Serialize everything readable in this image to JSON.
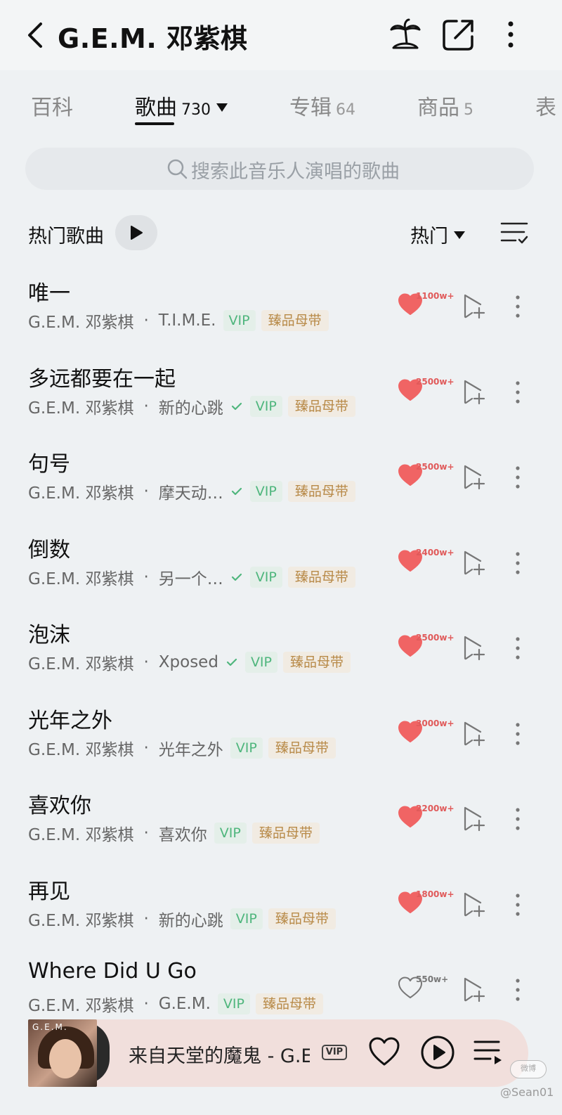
{
  "header": {
    "title": "G.E.M. 邓紫棋"
  },
  "tabs": [
    {
      "label": "百科",
      "count": ""
    },
    {
      "label": "歌曲",
      "count": "730"
    },
    {
      "label": "专辑",
      "count": "64"
    },
    {
      "label": "商品",
      "count": "5"
    },
    {
      "label": "表",
      "count": ""
    }
  ],
  "search": {
    "placeholder": "搜索此音乐人演唱的歌曲"
  },
  "section": {
    "title": "热门歌曲",
    "sort_label": "热门"
  },
  "songs": [
    {
      "title": "唯一",
      "artist": "G.E.M. 邓紫棋",
      "album": "T.I.M.E.",
      "verified": false,
      "vip": "VIP",
      "master": "臻品母带",
      "likes": "1100w+",
      "liked": true
    },
    {
      "title": "多远都要在一起",
      "artist": "G.E.M. 邓紫棋",
      "album": "新的心跳",
      "verified": true,
      "vip": "VIP",
      "master": "臻品母带",
      "likes": "2500w+",
      "liked": true
    },
    {
      "title": "句号",
      "artist": "G.E.M. 邓紫棋",
      "album": "摩天动…",
      "verified": true,
      "vip": "VIP",
      "master": "臻品母带",
      "likes": "2500w+",
      "liked": true
    },
    {
      "title": "倒数",
      "artist": "G.E.M. 邓紫棋",
      "album": "另一个…",
      "verified": true,
      "vip": "VIP",
      "master": "臻品母带",
      "likes": "2400w+",
      "liked": true
    },
    {
      "title": "泡沫",
      "artist": "G.E.M. 邓紫棋",
      "album": "Xposed",
      "verified": true,
      "vip": "VIP",
      "master": "臻品母带",
      "likes": "2500w+",
      "liked": true
    },
    {
      "title": "光年之外",
      "artist": "G.E.M. 邓紫棋",
      "album": "光年之外",
      "verified": false,
      "vip": "VIP",
      "master": "臻品母带",
      "likes": "3000w+",
      "liked": true
    },
    {
      "title": "喜欢你",
      "artist": "G.E.M. 邓紫棋",
      "album": "喜欢你",
      "verified": false,
      "vip": "VIP",
      "master": "臻品母带",
      "likes": "2200w+",
      "liked": true
    },
    {
      "title": "再见",
      "artist": "G.E.M. 邓紫棋",
      "album": "新的心跳",
      "verified": false,
      "vip": "VIP",
      "master": "臻品母带",
      "likes": "1800w+",
      "liked": true
    },
    {
      "title": "Where Did U Go",
      "artist": "G.E.M. 邓紫棋",
      "album": "G.E.M.",
      "verified": false,
      "vip": "VIP",
      "master": "臻品母带",
      "likes": "550w+",
      "liked": false
    }
  ],
  "player": {
    "song": "来自天堂的魔鬼 - G.E.M. 邓紫棋",
    "vip_badge": "VIP",
    "cover_text": "G.E.M."
  },
  "watermark": {
    "text": "@Sean01"
  },
  "colors": {
    "heart": "#f06464",
    "vip_green": "#4fb67d",
    "master_gold": "#b88a48",
    "background": "#eef1f3"
  }
}
